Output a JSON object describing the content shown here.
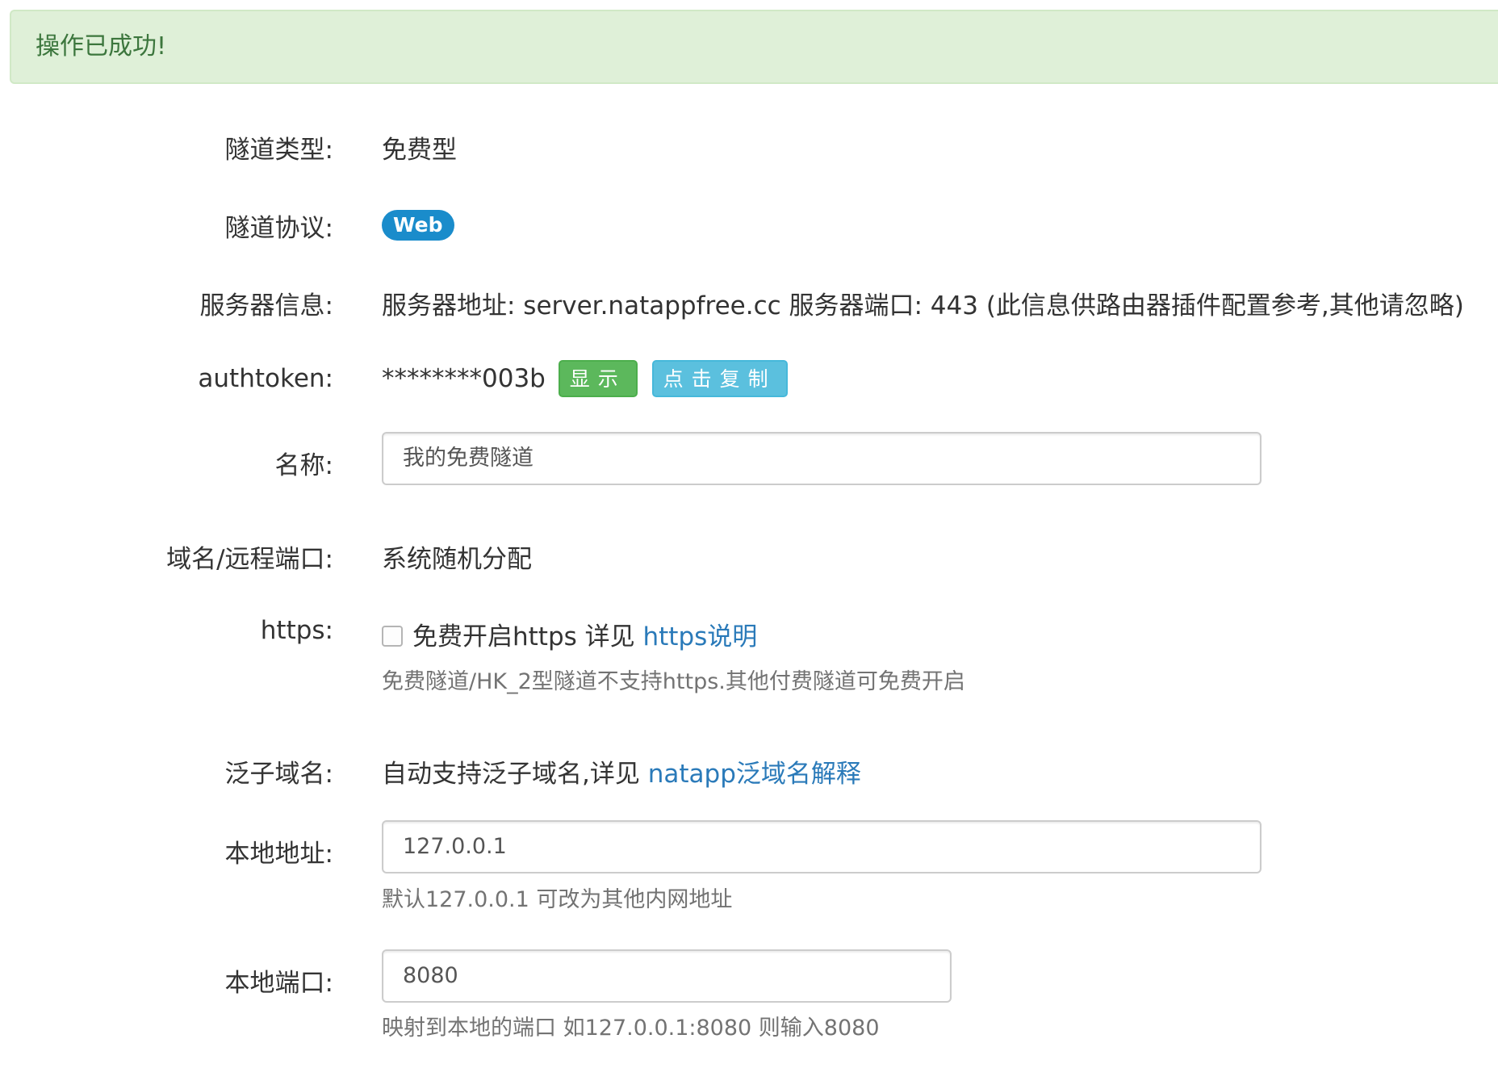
{
  "alert": {
    "message": "操作已成功!"
  },
  "form": {
    "tunnel_type": {
      "label": "隧道类型:",
      "value": "免费型"
    },
    "tunnel_protocol": {
      "label": "隧道协议:",
      "badge": "Web"
    },
    "server_info": {
      "label": "服务器信息:",
      "value": "服务器地址: server.natappfree.cc 服务器端口: 443 (此信息供路由器插件配置参考,其他请忽略)"
    },
    "authtoken": {
      "label": "authtoken:",
      "masked_value": "********003b",
      "show_button": "显示",
      "copy_button": "点击复制"
    },
    "name": {
      "label": "名称:",
      "value": "我的免费隧道"
    },
    "domain_port": {
      "label": "域名/远程端口:",
      "value": "系统随机分配"
    },
    "https": {
      "label": "https:",
      "checked": false,
      "checkbox_text": "免费开启https 详见",
      "link_text": "https说明",
      "help": "免费隧道/HK_2型隧道不支持https.其他付费隧道可免费开启"
    },
    "wildcard_domain": {
      "label": "泛子域名:",
      "text": "自动支持泛子域名,详见",
      "link_text": "natapp泛域名解释"
    },
    "local_address": {
      "label": "本地地址:",
      "value": "127.0.0.1",
      "help": "默认127.0.0.1 可改为其他内网地址"
    },
    "local_port": {
      "label": "本地端口:",
      "value": "8080",
      "help": "映射到本地的端口 如127.0.0.1:8080 则输入8080"
    }
  },
  "colors": {
    "alert_bg": "#dff0d8",
    "alert_text": "#3c763d",
    "badge": "#1a8ccb",
    "btn_success": "#5cb85c",
    "btn_info": "#5bc0de",
    "link": "#2a7ab9"
  }
}
